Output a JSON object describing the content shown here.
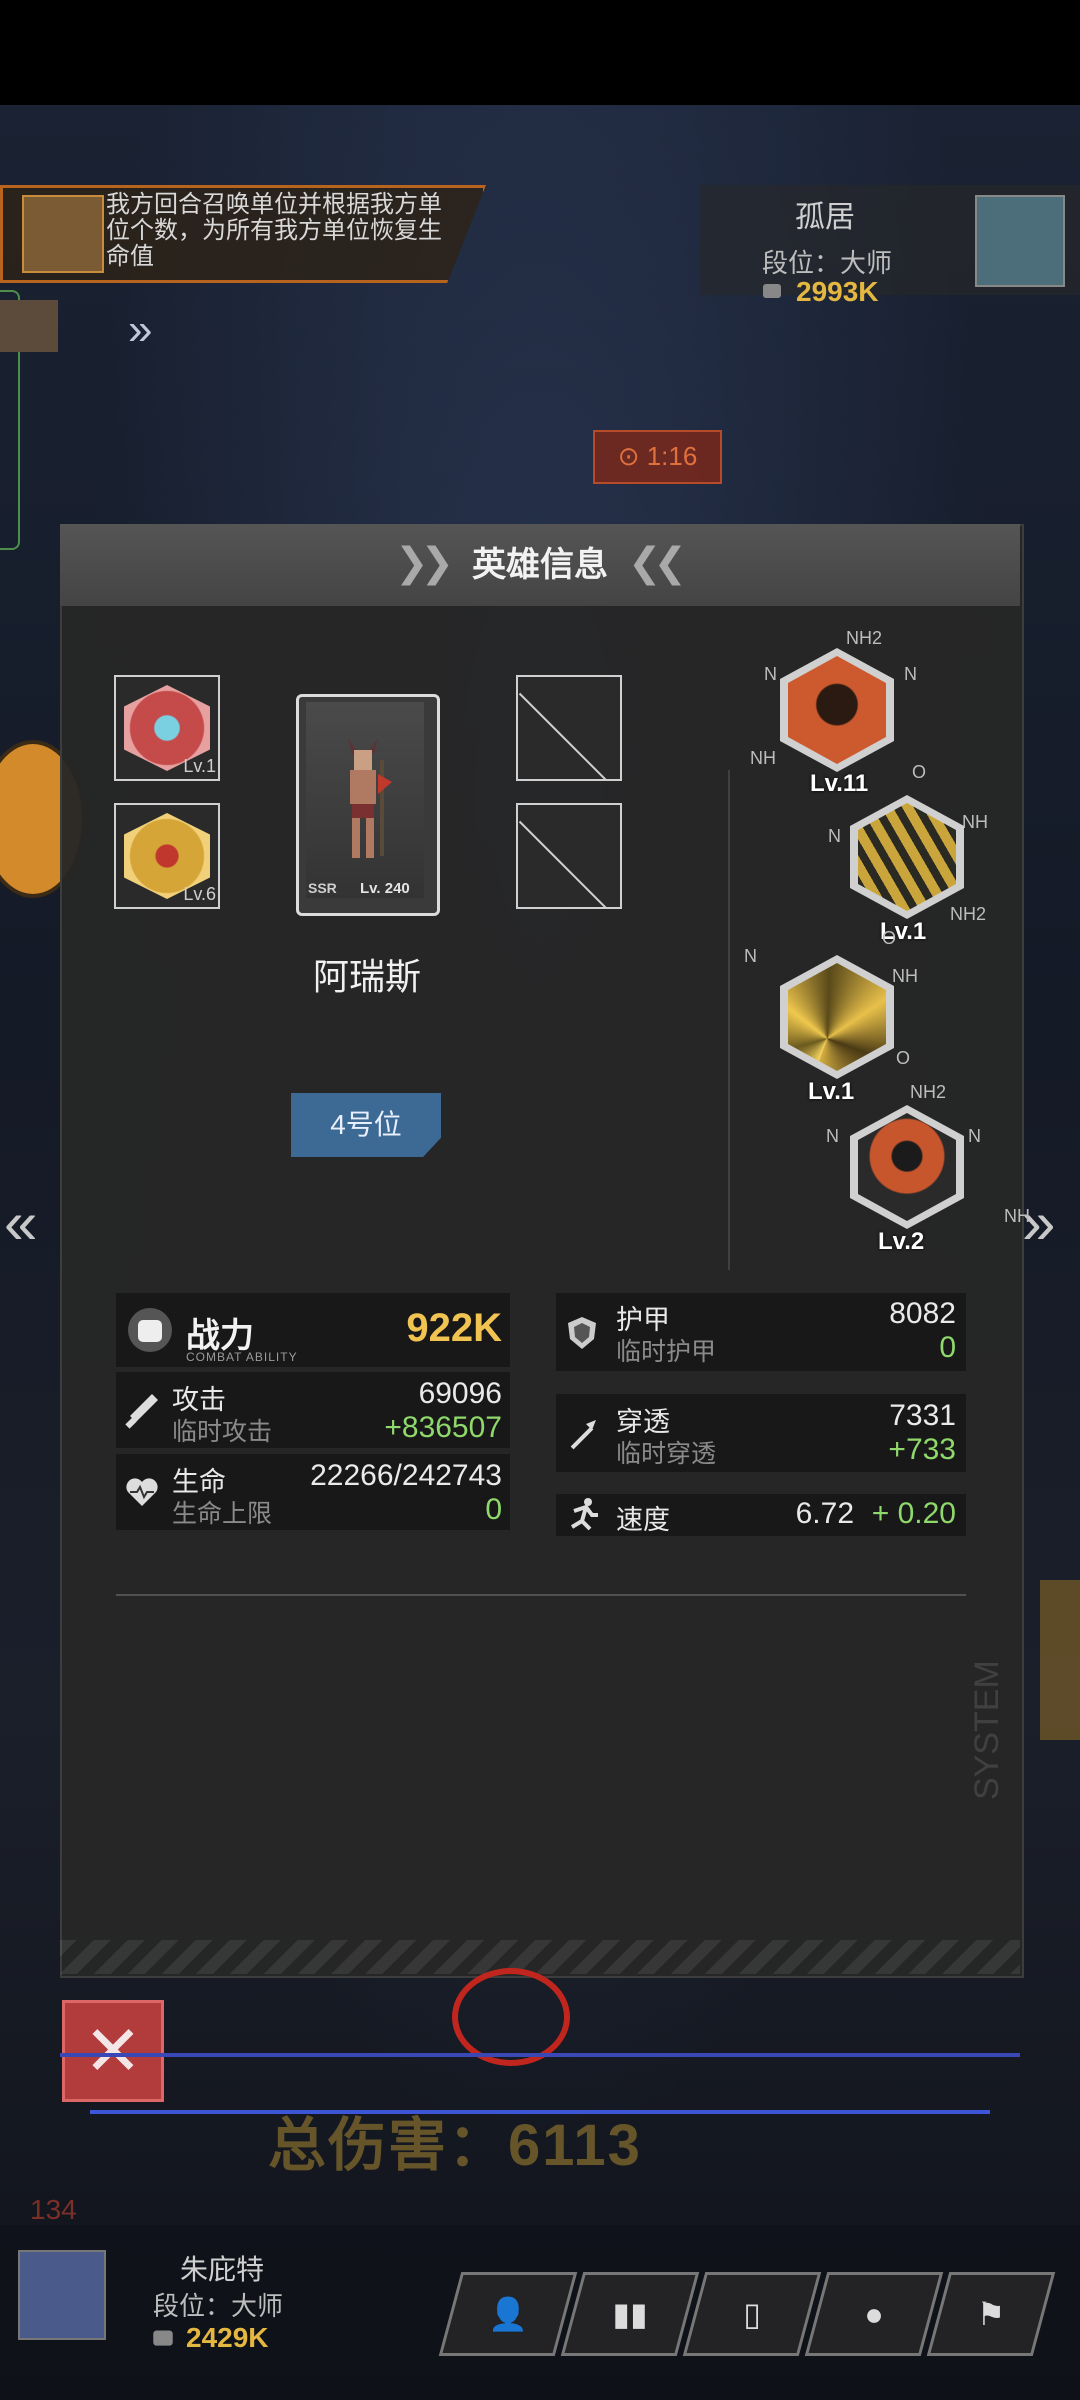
{
  "background": {
    "skill_text": "我方回合召唤单位并根据我方单位个数，为所有我方单位恢复生命值",
    "opponent": {
      "name": "孤居",
      "rank": "段位：大师",
      "power": "2993K"
    },
    "timer": "⊙ 1:16",
    "total_damage": "总伤害：6113",
    "left_counter": "134",
    "player": {
      "name": "朱庇特",
      "rank": "段位：大师",
      "power": "2429K"
    }
  },
  "modal": {
    "title": "英雄信息",
    "hero": {
      "name": "阿瑞斯",
      "rarity": "SSR",
      "level": "Lv. 240",
      "position": "4号位"
    },
    "equip_slots": [
      {
        "name": "emblem-1",
        "level": "Lv.1",
        "color": "#c54a4a"
      },
      {
        "name": "emblem-2",
        "level": "Lv.6",
        "color": "#d6a537"
      }
    ],
    "skills": [
      {
        "level": "Lv.11",
        "color": "#cc5a2e"
      },
      {
        "level": "Lv.1",
        "color": "#c9a53b"
      },
      {
        "level": "Lv.1",
        "color": "#d7b043"
      },
      {
        "level": "Lv.2",
        "color": "#c8562d"
      }
    ],
    "chem_labels": {
      "nh2": "NH2",
      "n": "N",
      "nh": "NH",
      "o": "O"
    },
    "stats": {
      "combat": {
        "label": "战力",
        "sub": "COMBAT ABILITY",
        "value": "922K"
      },
      "attack": {
        "label": "攻击",
        "value": "69096",
        "sub": "临时攻击",
        "bonus": "+836507"
      },
      "hp": {
        "label": "生命",
        "value": "22266/242743",
        "sub": "生命上限",
        "bonus": "0"
      },
      "armor": {
        "label": "护甲",
        "value": "8082",
        "sub": "临时护甲",
        "bonus": "0"
      },
      "pierce": {
        "label": "穿透",
        "value": "7331",
        "sub": "临时穿透",
        "bonus": "+733"
      },
      "speed": {
        "label": "速度",
        "value": "6.72",
        "bonus": "+ 0.20"
      }
    },
    "watermark": "SYSTEM",
    "close": "✕"
  },
  "colors": {
    "accent_gold": "#f1c451",
    "bonus_green": "#8fd86c",
    "position_blue": "#3d6a94",
    "close_red": "#b23b3b"
  },
  "bottom_buttons": [
    "user-icon",
    "chart-icon",
    "bottle-icon",
    "face-icon",
    "flag-icon"
  ]
}
